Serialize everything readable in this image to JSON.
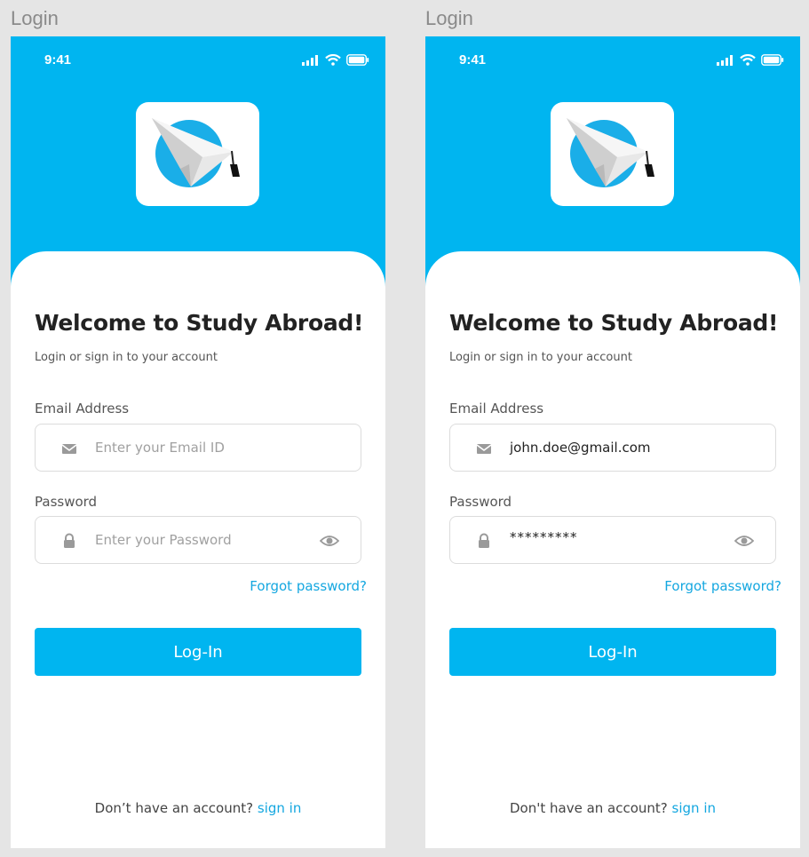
{
  "frames": [
    {
      "label": "Login",
      "status_time": "9:41",
      "title": "Welcome to Study Abroad!",
      "subtitle": "Login or sign in to your account",
      "email_label": "Email Address",
      "email_value": "",
      "email_placeholder": "Enter your Email ID",
      "password_label": "Password",
      "password_value": "",
      "password_placeholder": "Enter your Password",
      "forgot_label": "Forgot password?",
      "login_label": "Log-In",
      "footer_text": "Don’t have an account?",
      "footer_link": "sign in"
    },
    {
      "label": "Login",
      "status_time": "9:41",
      "title": "Welcome to Study Abroad!",
      "subtitle": "Login or sign in to your account",
      "email_label": "Email Address",
      "email_value": "john.doe@gmail.com",
      "email_placeholder": "Enter your Email ID",
      "password_label": "Password",
      "password_value": "*********",
      "password_placeholder": "Enter your Password",
      "forgot_label": "Forgot password?",
      "login_label": "Log-In",
      "footer_text": "Don't have an account?",
      "footer_link": "sign in"
    }
  ],
  "icons": {
    "email": "mail-icon",
    "password": "lock-icon",
    "toggle": "eye-icon",
    "logo": "paper-plane-graduation-logo"
  },
  "colors": {
    "accent": "#00b5f0",
    "link": "#14a7e0",
    "background": "#e5e5e5"
  }
}
